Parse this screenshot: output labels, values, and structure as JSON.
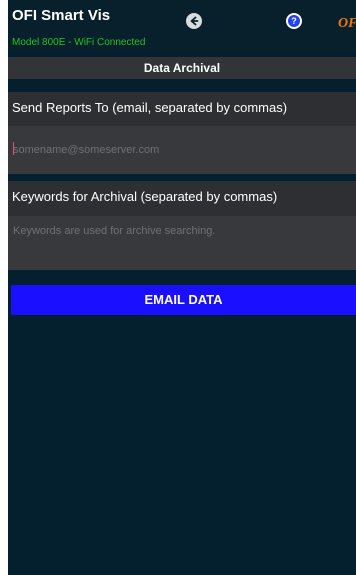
{
  "header": {
    "title": "OFI Smart Vis",
    "status": "Model 800E - WiFi Connected",
    "logo_text": "OFI",
    "back_icon": "arrow-left-circle-icon",
    "help_icon": "question-circle-icon",
    "help_glyph": "?"
  },
  "section": {
    "title": "Data Archival"
  },
  "form": {
    "recipients_label": "Send Reports To (email, separated by commas)",
    "recipients_placeholder": "somename@someserver.com",
    "recipients_value": "",
    "keywords_label": "Keywords for Archival (separated by commas)",
    "keywords_placeholder": "Keywords are used for archive searching.",
    "keywords_value": ""
  },
  "actions": {
    "email_label": "EMAIL DATA"
  },
  "colors": {
    "background": "#04202e",
    "status_text": "#22c322",
    "logo": "#f07a12",
    "primary_button": "#1a0fff"
  }
}
